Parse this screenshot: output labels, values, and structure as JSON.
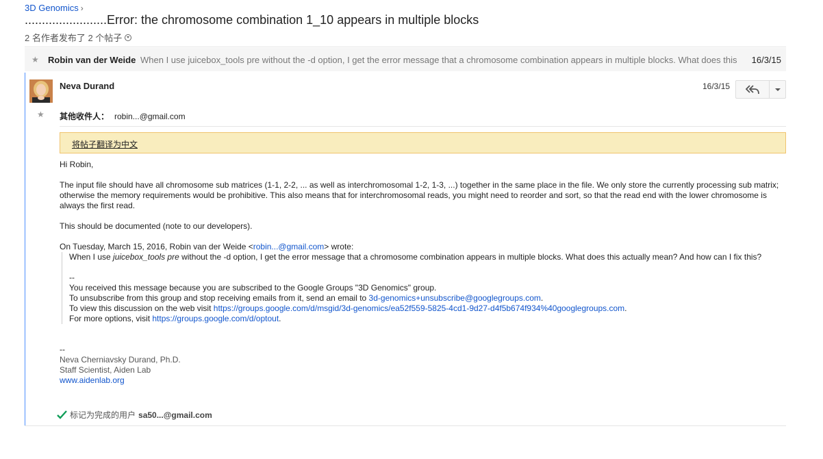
{
  "breadcrumb": {
    "group": "3D Genomics",
    "separator": "›"
  },
  "topic": {
    "title": "........................Error: the chromosome combination 1_10 appears in multiple blocks",
    "meta": "2 名作者发布了 2 个帖子"
  },
  "collapsed_message": {
    "author": "Robin van der Weide",
    "snippet": "When I use juicebox_tools pre without the -d option, I get the error message that a chromosome combination appears in multiple blocks. What does this",
    "date": "16/3/15"
  },
  "message": {
    "author": "Neva Durand",
    "date": "16/3/15",
    "recipients_label": "其他收件人：",
    "recipients_value": "robin...@gmail.com",
    "translate_label": "将帖子翻译为中文",
    "greeting": "Hi Robin,",
    "para1": "The input file should have all chromosome sub matrices  (1-1, 2-2, ... as well as interchromosomal 1-2, 1-3, ...) together in the same place in the file. We only store the currently processing sub matrix; otherwise the memory requirements would be prohibitive. This also means that for interchromosomal reads, you might need to reorder and sort, so that the read end with the lower chromosome is always the first read.",
    "para2": "This should be documented (note to our developers).",
    "quote_intro_pre": "On Tuesday, March 15, 2016, Robin van der Weide <",
    "quote_intro_email": "robin...@gmail.com",
    "quote_intro_post": "> wrote:",
    "quote": {
      "line_pre": "When I use ",
      "line_italic": "juicebox_tools pre",
      "line_post": " without the -d option, I get the error message that a chromosome combination appears in multiple blocks. What does this actually mean? And how can I fix this?",
      "sig_dash": "--",
      "sub_line": "You received this message because you are subscribed to the Google Groups \"3D Genomics\" group.",
      "unsub_pre": "To unsubscribe from this group and stop receiving emails from it, send an email to ",
      "unsub_email": "3d-genomics+unsubscribe@googlegroups.com",
      "unsub_post": ".",
      "view_pre": "To view this discussion on the web visit ",
      "view_link": "https://groups.google.com/d/msgid/3d-genomics/ea52f559-5825-4cd1-9d27-d4f5b674f934%40googlegroups.com",
      "view_post": ".",
      "opt_pre": "For more options, visit ",
      "opt_link": "https://groups.google.com/d/optout",
      "opt_post": "."
    },
    "signature": {
      "dash": "--",
      "name": "Neva Cherniavsky Durand, Ph.D.",
      "title": "Staff Scientist, Aiden Lab",
      "website": "www.aidenlab.org"
    }
  },
  "completed": {
    "label": "标记为完成的用户",
    "email": "sa50...@gmail.com"
  },
  "colors": {
    "accent": "#4d90fe",
    "link": "#1155cc",
    "translate_bg": "#f9edbe",
    "check": "#0f9d58"
  },
  "icons": [
    "star-icon",
    "chevron-down-circle-icon",
    "reply-all-icon",
    "dropdown-arrow-icon",
    "checkmark-icon"
  ]
}
